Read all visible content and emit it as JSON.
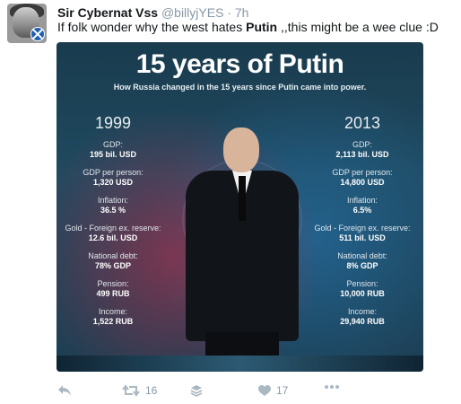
{
  "tweet": {
    "author_name": "Sir Cybernat Vss",
    "handle": "@billyjYES",
    "separator": "·",
    "time": "7h",
    "text_before": "If folk wonder why the west hates ",
    "text_bold": "Putin",
    "text_after": " ,,this might be a wee clue :D"
  },
  "infographic": {
    "title": "15 years of Putin",
    "subtitle": "How Russia changed in the 15 years since Putin came into power.",
    "left": {
      "year": "1999",
      "stats": [
        {
          "label": "GDP:",
          "value": "195 bil. USD"
        },
        {
          "label": "GDP per person:",
          "value": "1,320 USD"
        },
        {
          "label": "Inflation:",
          "value": "36.5 %"
        },
        {
          "label": "Gold - Foreign ex. reserve:",
          "value": "12.6 bil. USD"
        },
        {
          "label": "National debt:",
          "value": "78% GDP"
        },
        {
          "label": "Pension:",
          "value": "499 RUB"
        },
        {
          "label": "Income:",
          "value": "1,522 RUB"
        }
      ]
    },
    "right": {
      "year": "2013",
      "stats": [
        {
          "label": "GDP:",
          "value": "2,113 bil. USD"
        },
        {
          "label": "GDP per person:",
          "value": "14,800 USD"
        },
        {
          "label": "Inflation:",
          "value": "6.5%"
        },
        {
          "label": "Gold - Foreign ex. reserve:",
          "value": "511 bil. USD"
        },
        {
          "label": "National debt:",
          "value": "8% GDP"
        },
        {
          "label": "Pension:",
          "value": "10,000 RUB"
        },
        {
          "label": "Income:",
          "value": "29,940 RUB"
        }
      ]
    }
  },
  "actions": {
    "reply_icon": "reply-icon",
    "retweet_icon": "retweet-icon",
    "retweet_count": "16",
    "buffer_icon": "buffer-icon",
    "like_icon": "heart-icon",
    "like_count": "17",
    "more_icon": "more-icon"
  },
  "colors": {
    "name_text": "#14171a",
    "meta_text": "#8899a6",
    "action_icon": "#aab8c2"
  }
}
